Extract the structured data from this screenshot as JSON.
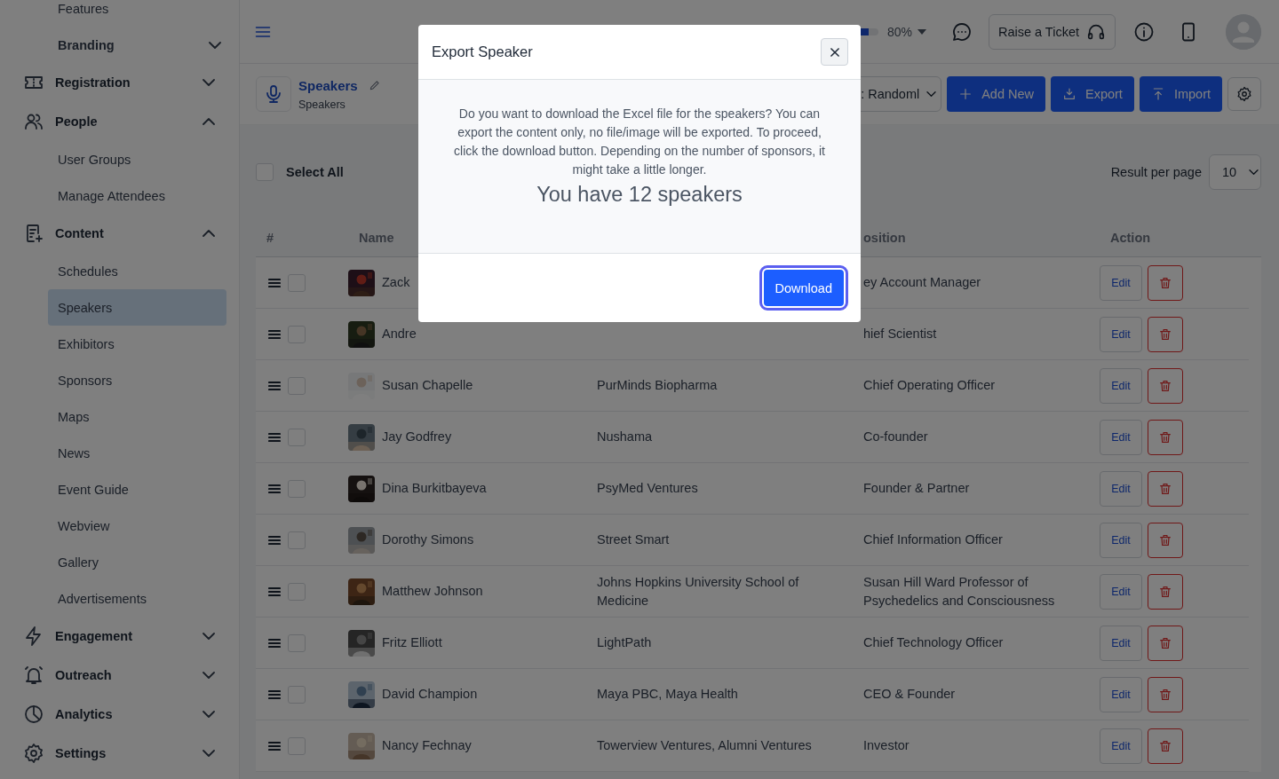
{
  "sidebar": {
    "continued_items": [
      {
        "label": "Features",
        "kind": "link"
      },
      {
        "label": "Branding",
        "kind": "group",
        "expanded": false
      }
    ],
    "sections": [
      {
        "label": "Registration",
        "expanded": false
      },
      {
        "label": "People",
        "expanded": true,
        "children": [
          {
            "label": "User Groups",
            "selected": false
          },
          {
            "label": "Manage Attendees",
            "selected": false
          }
        ]
      },
      {
        "label": "Content",
        "expanded": true,
        "children": [
          {
            "label": "Schedules",
            "selected": false
          },
          {
            "label": "Speakers",
            "selected": true
          },
          {
            "label": "Exhibitors",
            "selected": false
          },
          {
            "label": "Sponsors",
            "selected": false
          },
          {
            "label": "Maps",
            "selected": false
          },
          {
            "label": "News",
            "selected": false
          },
          {
            "label": "Event Guide",
            "selected": false
          },
          {
            "label": "Webview",
            "selected": false
          },
          {
            "label": "Gallery",
            "selected": false
          },
          {
            "label": "Advertisements",
            "selected": false
          }
        ]
      },
      {
        "label": "Engagement",
        "expanded": false
      },
      {
        "label": "Outreach",
        "expanded": false
      },
      {
        "label": "Analytics",
        "expanded": false
      },
      {
        "label": "Settings",
        "expanded": false
      }
    ]
  },
  "header": {
    "progress": {
      "level": 0.8,
      "reading": "80%"
    },
    "ticket_button": "Raise a Ticket"
  },
  "toolbar": {
    "title": "Speakers",
    "subtitle": "Speakers",
    "sort_select": ": Randoml",
    "buttons": [
      "Add New",
      "Export",
      "Import"
    ]
  },
  "list_controls": {
    "select_all": {
      "label": "Select All",
      "checked": false
    },
    "per_page": {
      "label": "Result per page",
      "value": "10"
    }
  },
  "table": {
    "columns": [
      "#",
      "Name",
      "osition",
      "Action"
    ],
    "rows": [
      {
        "name": "Zack",
        "position": "ey Account Manager",
        "checked": false,
        "edit": "Edit"
      },
      {
        "name": "Andre",
        "position": "hief Scientist",
        "checked": false,
        "edit": "Edit"
      },
      {
        "name": "Susan Chapelle",
        "company": "PurMinds Biopharma",
        "position": "Chief Operating Officer",
        "checked": false,
        "edit": "Edit"
      },
      {
        "name": "Jay Godfrey",
        "company": "Nushama",
        "position": "Co-founder",
        "checked": false,
        "edit": "Edit"
      },
      {
        "name": "Dina Burkitbayeva",
        "company": "PsyMed Ventures",
        "position": "Founder & Partner",
        "checked": false,
        "edit": "Edit"
      },
      {
        "name": "Dorothy Simons",
        "company": "Street Smart",
        "position": "Chief Information Officer",
        "checked": false,
        "edit": "Edit"
      },
      {
        "name": "Matthew Johnson",
        "company": "Johns Hopkins University School of Medicine",
        "position": "Susan Hill Ward Professor of Psychedelics and Consciousness",
        "checked": false,
        "edit": "Edit"
      },
      {
        "name": "Fritz Elliott",
        "company": "LightPath",
        "position": "Chief Technology Officer",
        "checked": false,
        "edit": "Edit"
      },
      {
        "name": "David Champion",
        "company": "Maya PBC, Maya Health",
        "position": "CEO & Founder",
        "checked": false,
        "edit": "Edit"
      },
      {
        "name": "Nancy Fechnay",
        "company": "Towerview Ventures, Alumni Ventures",
        "position": "Investor",
        "checked": false,
        "edit": "Edit"
      }
    ]
  },
  "modal": {
    "title": "Export Speaker",
    "message": "Do you want to download the Excel file for the speakers? You can export the content only, no file/image will be exported. To proceed, click the download button. Depending on the number of sponsors, it might take a little longer.",
    "count_text": "You have 12 speakers",
    "button": "Download"
  }
}
